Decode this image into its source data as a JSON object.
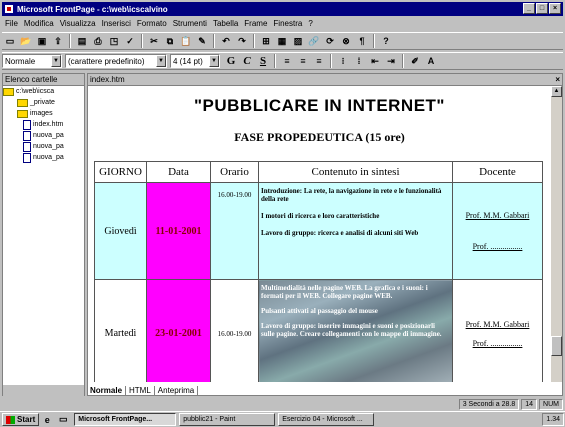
{
  "window": {
    "title": "Microsoft FrontPage - c:\\web\\icscalvino"
  },
  "menu": [
    "File",
    "Modifica",
    "Visualizza",
    "Inserisci",
    "Formato",
    "Strumenti",
    "Tabella",
    "Frame",
    "Finestra",
    "?"
  ],
  "format_bar": {
    "style": "Normale",
    "font": "(carattere predefinito)",
    "size": "4 (14 pt)",
    "bold": "G",
    "italic": "C",
    "underline": "S"
  },
  "folders": {
    "header": "Elenco cartelle",
    "root": "c:\\web\\icsca",
    "items": [
      "_private",
      "images",
      "index.htm",
      "nuova_pa",
      "nuova_pa",
      "nuova_pa"
    ]
  },
  "editor": {
    "filename": "index.htm",
    "close": "×"
  },
  "page": {
    "title": "\"PUBBLICARE IN INTERNET\"",
    "subtitle": "FASE PROPEDEUTICA (15 ore)"
  },
  "table": {
    "headers": [
      "GIORNO",
      "Data",
      "Orario",
      "Contenuto in sintesi",
      "Docente"
    ],
    "rows": [
      {
        "giorno": "Giovedì",
        "data": "11-01-2001",
        "orario": "16.00-19.00",
        "contenuto": [
          "Introduzione: La rete, la navigazione in rete e le funzionalità della rete",
          "I motori di ricerca e loro caratteristiche",
          "Lavoro di gruppo: ricerca e analisi di alcuni siti Web"
        ],
        "docente1": "Prof. M.M. Gabbari",
        "docente2": "Prof. ................"
      },
      {
        "giorno": "Martedì",
        "data": "23-01-2001",
        "orario": "16.00-19.00",
        "contenuto": [
          "Multimedialità nelle pagine WEB. La grafica e i suoni: i formati per il WEB. Collegare pagine WEB.",
          "Pulsanti attivati al passaggio del mouse",
          "Lavoro di gruppo: inserire immagini e suoni e posizionarli sulle pagine. Creare collegamenti con le mappe di immagine."
        ],
        "docente1": "Prof. M.M. Gabbari",
        "docente2": "Prof. ................"
      }
    ]
  },
  "view_tabs": [
    "Normale",
    "HTML",
    "Anteprima"
  ],
  "status": {
    "time_estimate": "3 Secondi a 28.8",
    "clock": "14",
    "num": "NUM"
  },
  "taskbar": {
    "start": "Start",
    "tasks": [
      "Microsoft FrontPage...",
      "pubblic21 - Paint",
      "Esercizio 04 - Microsoft ..."
    ],
    "time": "1.34"
  }
}
